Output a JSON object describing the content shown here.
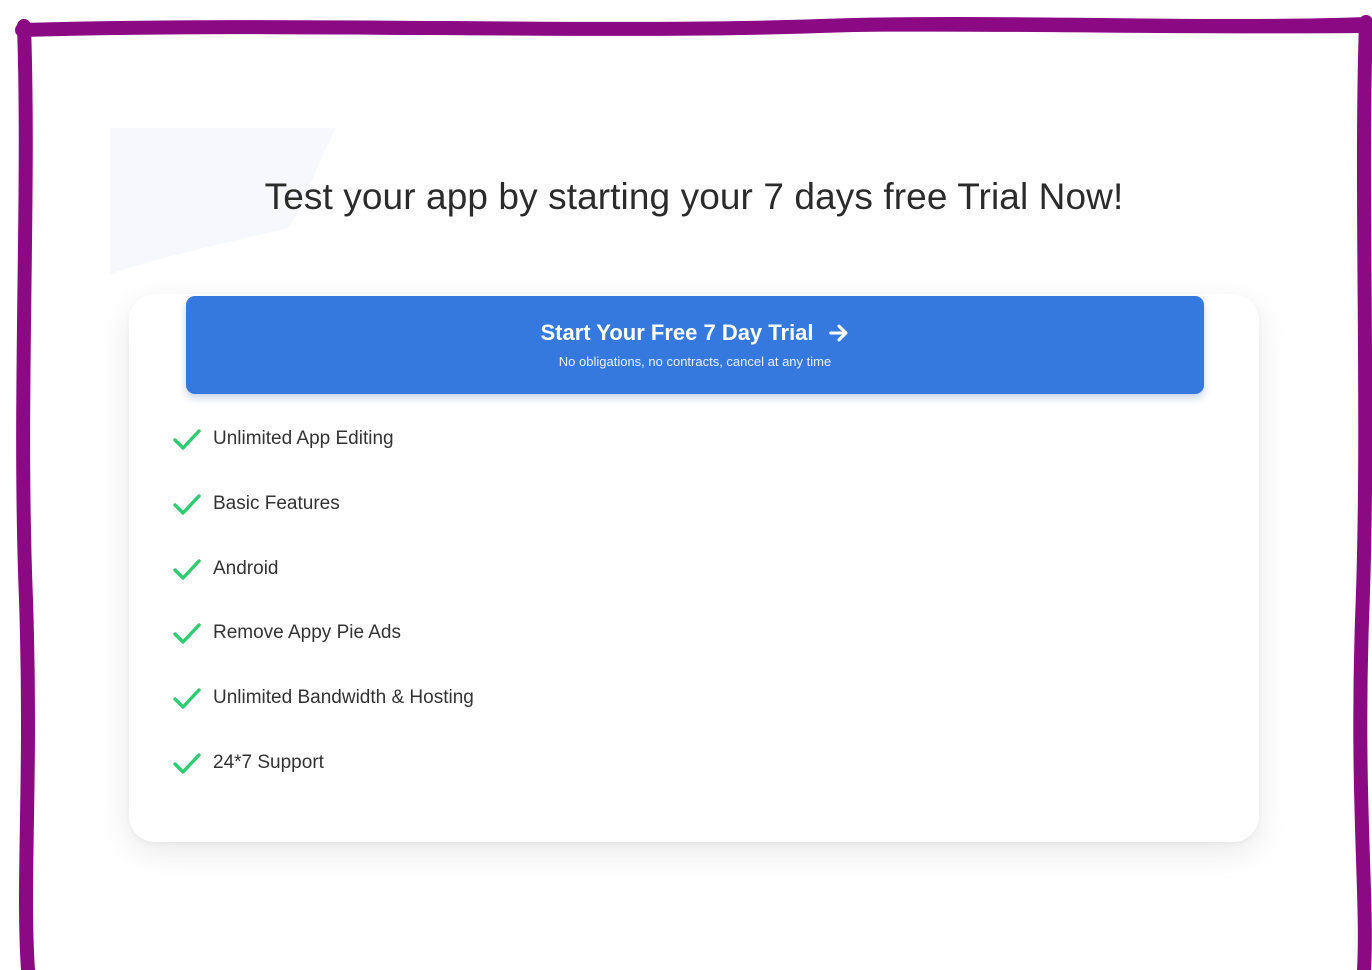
{
  "headline": "Test your app by starting your 7 days free Trial Now!",
  "cta": {
    "title": "Start Your Free 7 Day Trial",
    "subtitle": "No obligations, no contracts, cancel at any time",
    "icon": "arrow-right-icon",
    "color": "#3579df"
  },
  "features": [
    "Unlimited App Editing",
    "Basic Features",
    "Android",
    "Remove Appy Pie Ads",
    "Unlimited Bandwidth & Hosting",
    "24*7 Support"
  ],
  "feature_icon": "check-icon",
  "colors": {
    "check": "#2ecc71",
    "frame": "#8b0a84",
    "headline": "#2b2b2b"
  }
}
